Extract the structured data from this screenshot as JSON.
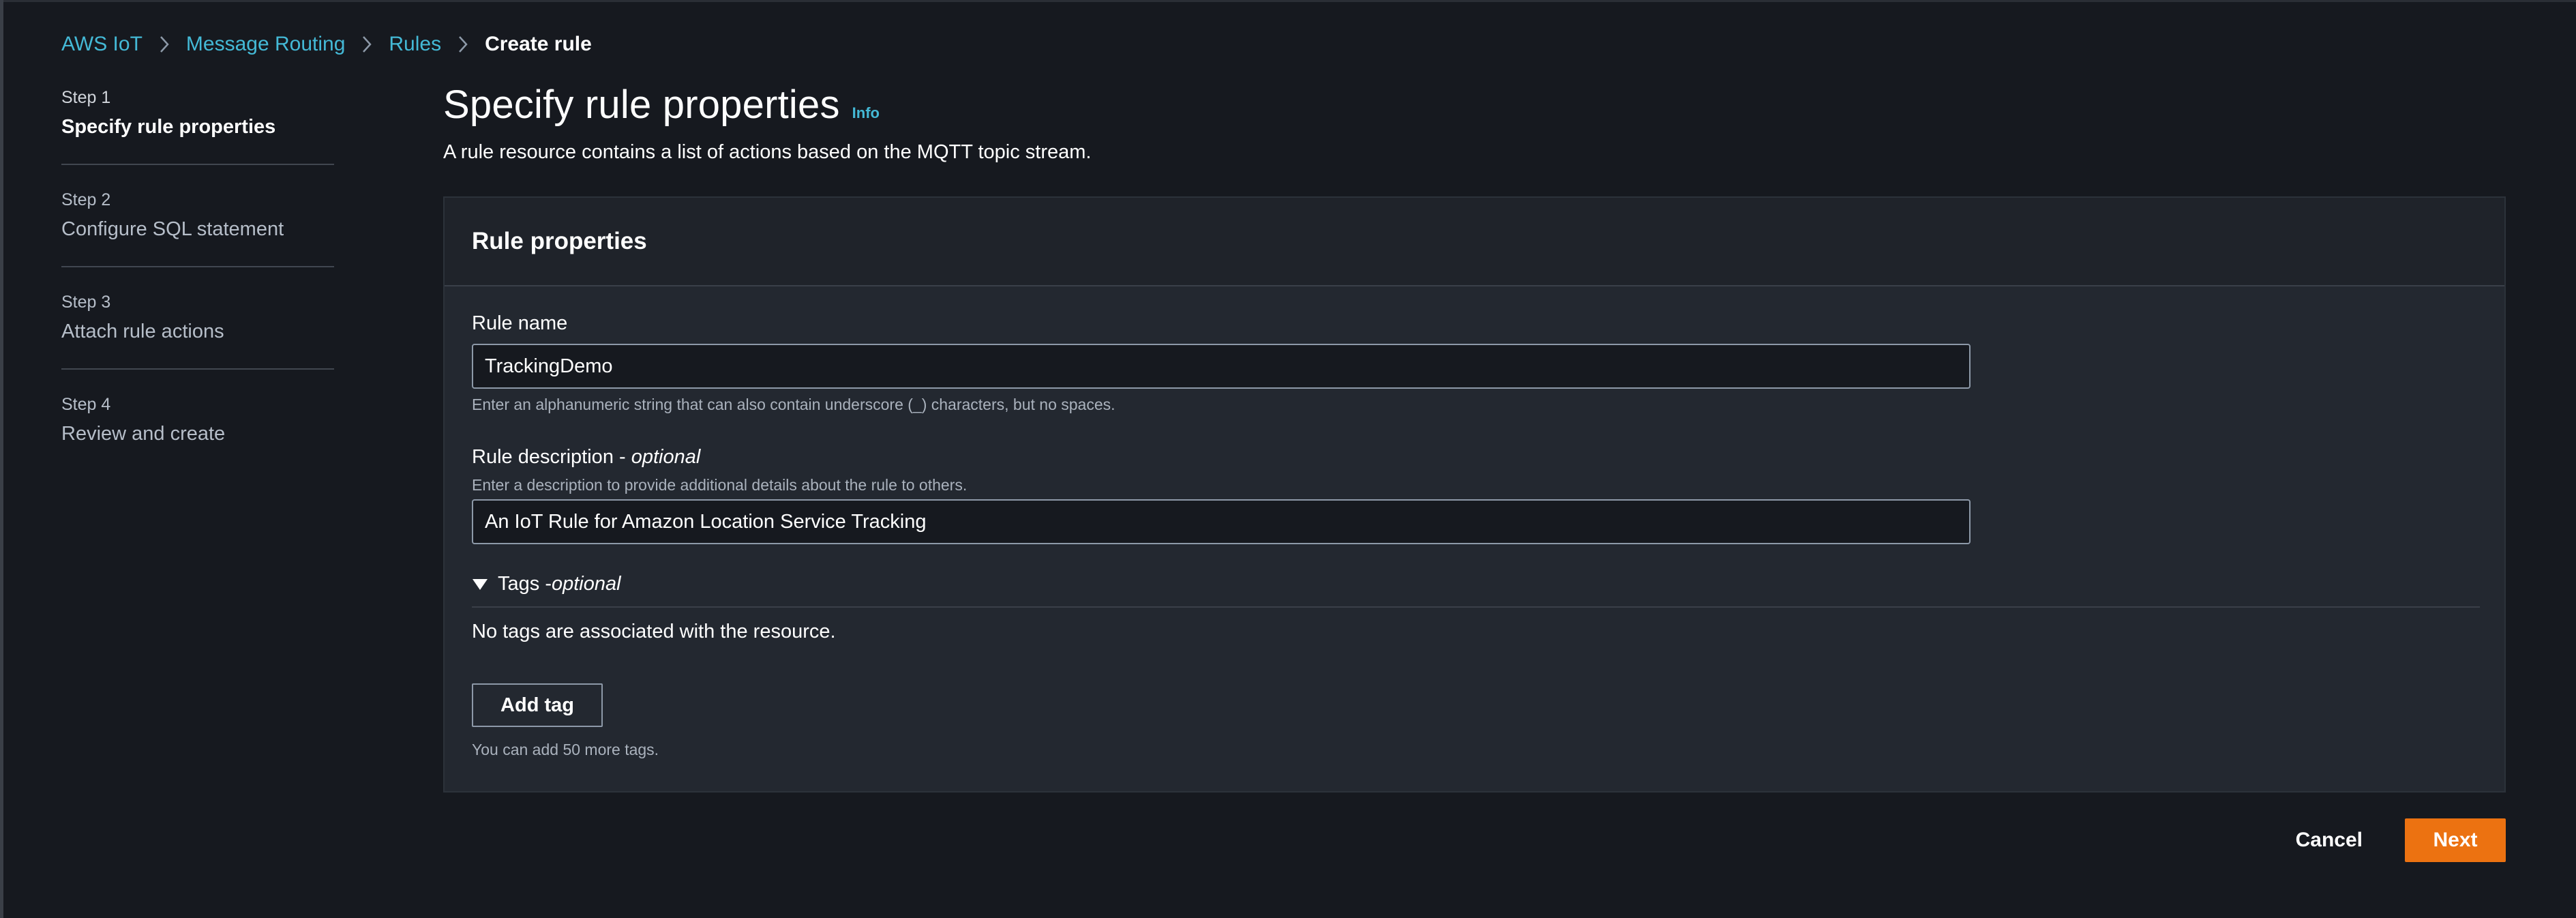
{
  "breadcrumb": {
    "items": [
      "AWS IoT",
      "Message Routing",
      "Rules"
    ],
    "current": "Create rule"
  },
  "steps": [
    {
      "number": "Step 1",
      "title": "Specify rule properties",
      "active": true
    },
    {
      "number": "Step 2",
      "title": "Configure SQL statement",
      "active": false
    },
    {
      "number": "Step 3",
      "title": "Attach rule actions",
      "active": false
    },
    {
      "number": "Step 4",
      "title": "Review and create",
      "active": false
    }
  ],
  "page": {
    "title": "Specify rule properties",
    "info": "Info",
    "description": "A rule resource contains a list of actions based on the MQTT topic stream."
  },
  "panel": {
    "title": "Rule properties",
    "rule_name": {
      "label": "Rule name",
      "value": "TrackingDemo",
      "hint": "Enter an alphanumeric string that can also contain underscore (_) characters, but no spaces."
    },
    "rule_description": {
      "label": "Rule description - ",
      "label_optional": "optional",
      "hint": "Enter a description to provide additional details about the rule to others.",
      "value": "An IoT Rule for Amazon Location Service Tracking"
    },
    "tags": {
      "label": "Tags - ",
      "label_optional": "optional",
      "empty_message": "No tags are associated with the resource.",
      "add_button": "Add tag",
      "limit_hint": "You can add 50 more tags."
    }
  },
  "actions": {
    "cancel": "Cancel",
    "next": "Next"
  },
  "colors": {
    "background": "#16191f",
    "link": "#44b9d6",
    "primary": "#ec7211",
    "panel": "#232830"
  }
}
